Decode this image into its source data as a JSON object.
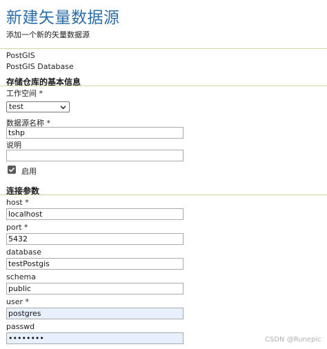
{
  "page": {
    "title": "新建矢量数据源",
    "subtitle": "添加一个新的矢量数据源"
  },
  "store_type": {
    "type": "PostGIS",
    "description": "PostGIS Database"
  },
  "basic_info": {
    "heading": "存储仓库的基本信息",
    "workspace_label": "工作空间 *",
    "workspace_value": "test",
    "name_label": "数据源名称 *",
    "name_value": "tshp",
    "description_label": "说明",
    "description_value": "",
    "enabled_label": "启用",
    "enabled_checked": true
  },
  "connection": {
    "heading": "连接参数",
    "host_label": "host *",
    "host_value": "localhost",
    "port_label": "port *",
    "port_value": "5432",
    "database_label": "database",
    "database_value": "testPostgis",
    "schema_label": "schema",
    "schema_value": "public",
    "user_label": "user *",
    "user_value": "postgres",
    "passwd_label": "passwd",
    "passwd_value": "••••••••"
  },
  "watermark": "CSDN @Runepic",
  "colors": {
    "title": "#2c6da8",
    "divider": "#c9d6a4",
    "autofill_bg": "#e8f0fe"
  }
}
